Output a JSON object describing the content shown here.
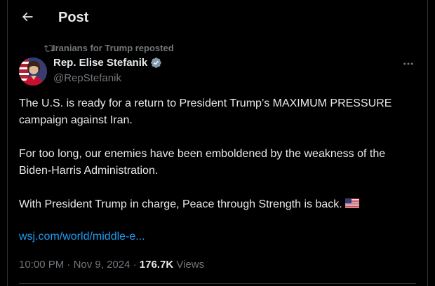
{
  "header": {
    "title": "Post",
    "back_icon": "arrow-left-icon"
  },
  "repost": {
    "icon": "repost-icon",
    "text": "Iranians for Trump reposted"
  },
  "author": {
    "name": "Rep. Elise Stefanik",
    "handle": "@RepStefanik",
    "verified_icon": "verified-badge-icon",
    "verified_color": "#829aab"
  },
  "post": {
    "paragraphs": [
      "The U.S. is ready for a return to President Trump’s MAXIMUM PRESSURE campaign against Iran.",
      "For too long, our enemies have been emboldened by the weakness of the Biden-Harris Administration.",
      "With President Trump in charge, Peace through Strength is back."
    ],
    "flag_icon": "us-flag-icon",
    "link": "wsj.com/world/middle-e..."
  },
  "meta": {
    "time": "10:00 PM",
    "separator": "·",
    "date": "Nov 9, 2024",
    "views_count": "176.7K",
    "views_label": "Views"
  },
  "colors": {
    "background": "#000000",
    "text": "#e7e9ea",
    "muted": "#71767b",
    "link": "#1d9bf0",
    "border": "#2f3336"
  }
}
